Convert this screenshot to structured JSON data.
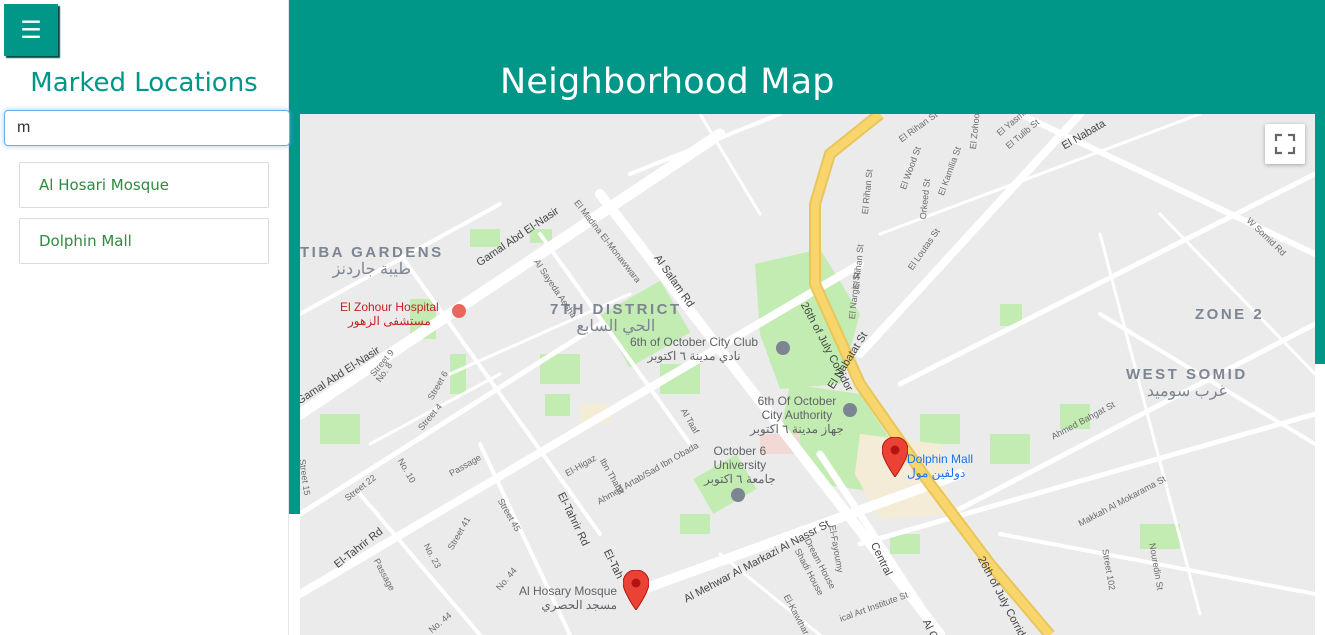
{
  "header": {
    "title": "Neighborhood Map"
  },
  "sidebar": {
    "menu_icon": "☰",
    "title": "Marked Locations",
    "filter_value": "m",
    "locations": [
      {
        "name": "Al Hosari Mosque"
      },
      {
        "name": "Dolphin Mall"
      }
    ]
  },
  "colors": {
    "accent": "#009688",
    "list_text": "#2e8b3e",
    "marker": "#ea4335",
    "highway": "#f8d66d",
    "park": "#c3ecb2"
  },
  "map": {
    "icons": [
      "fullscreen-icon",
      "location-marker-icon",
      "hospital-icon",
      "landmark-icon",
      "university-icon"
    ],
    "districts": {
      "tiba_en": "TIBA GARDENS",
      "tiba_ar": "طيبة جاردنز",
      "d7_en": "7TH DISTRICT",
      "d7_ar": "الحي السابع",
      "zone2": "ZONE 2",
      "wsomid_en": "WEST SOMID",
      "wsomid_ar": "غرب سوميد"
    },
    "pois": {
      "hospital_en": "El Zohour Hospital",
      "hospital_ar": "مستشفى الزهور",
      "club_en": "6th of October City Club",
      "club_ar": "نادي مدينة ٦ اكتوبر",
      "authority_en1": "6th Of October",
      "authority_en2": "City Authority",
      "authority_ar": "جهاز مدينة ٦ اكتوبر",
      "univ_en1": "October 6",
      "univ_en2": "University",
      "univ_ar": "جامعة ٦ اكتوبر",
      "mall_en": "Dolphin Mall",
      "mall_ar": "دولفين مول",
      "mosque_en": "Al Hosary Mosque",
      "mosque_ar": "مسجد الحصري"
    },
    "streets": {
      "gamal1": "Gamal Abd El-Nasir",
      "gamal2": "Gamal Abd El-Nasir",
      "salam": "Al Salam Rd",
      "corridor1": "26th of July Corridor",
      "corridor2": "26th of July Corridor",
      "nabatat1": "El Nabatat St",
      "nabatat2": "El Nabata",
      "tahrir1": "El-Tahrir Rd",
      "tahrir2": "El-Tahrir Rd",
      "tahrir3": "El-Tah",
      "mehwar": "Al Mehwar Al Markazi Al Nassr St",
      "central": "Central",
      "wsomidrd": "W Somid Rd",
      "bahgat": "Ahmed Bahgat St",
      "makkah": "Makkah Al Mokarama St",
      "nouredin": "Nouredin St",
      "st102": "Street 102",
      "ibnthabit": "Ibn Thabit",
      "artab": "Ahmed Artab/Sad Ibn Obada",
      "higaz": "El-Higaz",
      "taaf": "Al Taaf",
      "sayeda": "Al Sayeda Aesha",
      "madina": "El Madina El-Monawwara",
      "rihan1": "El Rihan St",
      "rihan2": "El Rihan St",
      "rihan3": "El Rihan St",
      "zohoor": "El Zohoor St",
      "yasmin": "El Yasmin St",
      "tulib": "El Tulib St",
      "wood": "El Wood St",
      "kamilia": "El Kamilia St",
      "orkeed": "Orkeed St",
      "loutas": "El Loutas St",
      "nargis": "El Nargis St",
      "street9": "Street 9",
      "street6": "Street 6",
      "street4": "Street 4",
      "street8": "No. 8",
      "no10": "No. 10",
      "street22": "Street 22",
      "street45": "Street 45",
      "street41": "Street 41",
      "street15": "Street 15",
      "no23": "No. 23",
      "no44": "No. 44",
      "no44b": "No. 44",
      "passage1": "Passage",
      "passage2": "Passage",
      "dream": "Dream House",
      "shadi": "Shadi House",
      "fayoumy": "El-Fayoumy",
      "kawthar": "El-Kawthar",
      "arts": "ical Art Institute St",
      "central2": "Al Ce"
    }
  }
}
